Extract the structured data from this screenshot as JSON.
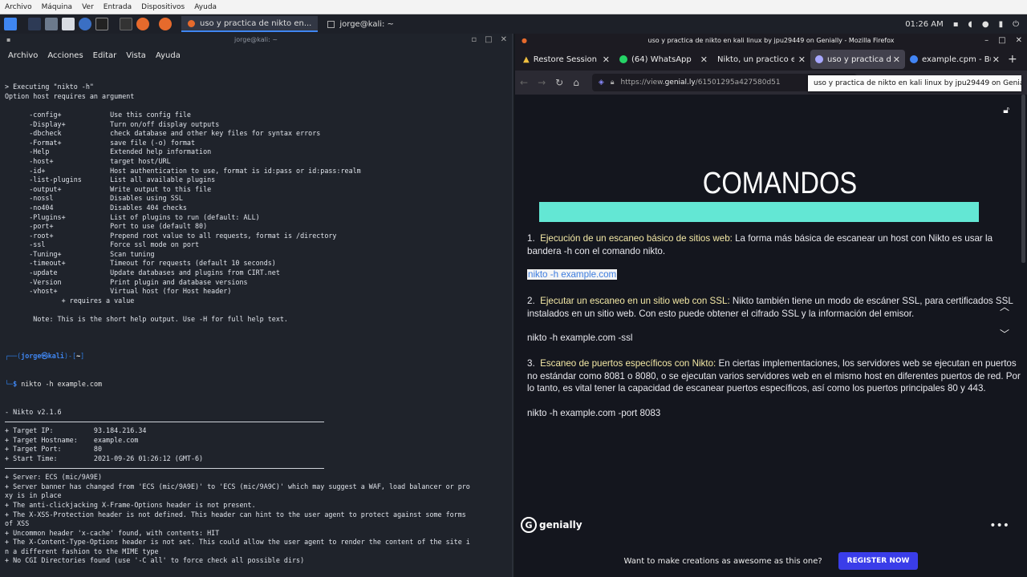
{
  "vm_menu": [
    "Archivo",
    "Máquina",
    "Ver",
    "Entrada",
    "Dispositivos",
    "Ayuda"
  ],
  "panel": {
    "task1": "uso y practica de nikto en...",
    "task2": "jorge@kali: ~",
    "clock": "01:26 AM"
  },
  "terminal": {
    "title": "jorge@kali: ~",
    "menu": [
      "Archivo",
      "Acciones",
      "Editar",
      "Vista",
      "Ayuda"
    ],
    "lines_top": [
      "> Executing \"nikto -h\"",
      "Option host requires an argument",
      "",
      "      -config+            Use this config file",
      "      -Display+           Turn on/off display outputs",
      "      -dbcheck            check database and other key files for syntax errors",
      "      -Format+            save file (-o) format",
      "      -Help               Extended help information",
      "      -host+              target host/URL",
      "      -id+                Host authentication to use, format is id:pass or id:pass:realm",
      "      -list-plugins       List all available plugins",
      "      -output+            Write output to this file",
      "      -nossl              Disables using SSL",
      "      -no404              Disables 404 checks",
      "      -Plugins+           List of plugins to run (default: ALL)",
      "      -port+              Port to use (default 80)",
      "      -root+              Prepend root value to all requests, format is /directory",
      "      -ssl                Force ssl mode on port",
      "      -Tuning+            Scan tuning",
      "      -timeout+           Timeout for requests (default 10 seconds)",
      "      -update             Update databases and plugins from CIRT.net",
      "      -Version            Print plugin and database versions",
      "      -vhost+             Virtual host (for Host header)",
      "              + requires a value",
      "",
      "       Note: This is the short help output. Use -H for full help text.",
      ""
    ],
    "prompt_user": "jorge㉿kali",
    "prompt_dir": "~",
    "prompt_cmd": "nikto -h example.com",
    "lines_scan": [
      "- Nikto v2.1.6",
      "---",
      "+ Target IP:          93.184.216.34",
      "+ Target Hostname:    example.com",
      "+ Target Port:        80",
      "+ Start Time:         2021-09-26 01:26:12 (GMT-6)",
      "---",
      "+ Server: ECS (mic/9A9E)",
      "+ Server banner has changed from 'ECS (mic/9A9E)' to 'ECS (mic/9A9C)' which may suggest a WAF, load balancer or pro",
      "xy is in place",
      "+ The anti-clickjacking X-Frame-Options header is not present.",
      "+ The X-XSS-Protection header is not defined. This header can hint to the user agent to protect against some forms",
      "of XSS",
      "+ Uncommon header 'x-cache' found, with contents: HIT",
      "+ The X-Content-Type-Options header is not set. This could allow the user agent to render the content of the site i",
      "n a different fashion to the MIME type",
      "+ No CGI Directories found (use '-C all' to force check all possible dirs)"
    ]
  },
  "firefox": {
    "title": "uso y practica de nikto en kali linux by jpu29449 on Genially - Mozilla Firefox",
    "tabs": [
      {
        "label": "Restore Session",
        "color": "#e0e0e0",
        "active": false
      },
      {
        "label": "(64) WhatsApp",
        "color": "#25d366",
        "active": false
      },
      {
        "label": "Nikto, un practico esc",
        "color": "",
        "active": false
      },
      {
        "label": "uso y practica de nikto",
        "color": "#a7a7ff",
        "active": true
      },
      {
        "label": "example.cpm - Bu",
        "color": "#4285f4",
        "active": false
      }
    ],
    "url_prefix": "https://view.",
    "url_host": "genial.ly",
    "url_rest": "/61501295a427580d51",
    "tooltip": "uso y practica de nikto en kali linux by jpu29449 on Genially"
  },
  "page": {
    "heading": "COMANDOS",
    "item1_num": "1.",
    "item1_title": "Ejecución de un escaneo básico de sitios web:",
    "item1_text": " La forma más básica de escanear un host con Nikto es usar la bandera -h con el comando nikto.",
    "code1": "nikto -h example.com",
    "item2_num": "2.",
    "item2_title": "Ejecutar un escaneo en un sitio web con SSL:",
    "item2_text": " Nikto también tiene un modo de escáner SSL, para certificados SSL instalados en un sitio web. Con esto puede obtener el cifrado SSL y la información del emisor.",
    "code2": "nikto -h example.com -ssl",
    "item3_num": "3.",
    "item3_title": "Escaneo de puertos específicos con Nikto:",
    "item3_text": " En ciertas implementaciones, los servidores web se ejecutan en puertos no estándar como 8081 o 8080, o se ejecutan varios servidores web en el mismo host en diferentes puertos de red. Por lo tanto, es vital tener la capacidad de escanear puertos específicos, así como los puertos principales 80 y 443.",
    "code3": "nikto -h example.com -port 8083",
    "logo": "genially",
    "promo": "Want to make creations as awesome as this one?",
    "register": "REGISTER NOW"
  }
}
